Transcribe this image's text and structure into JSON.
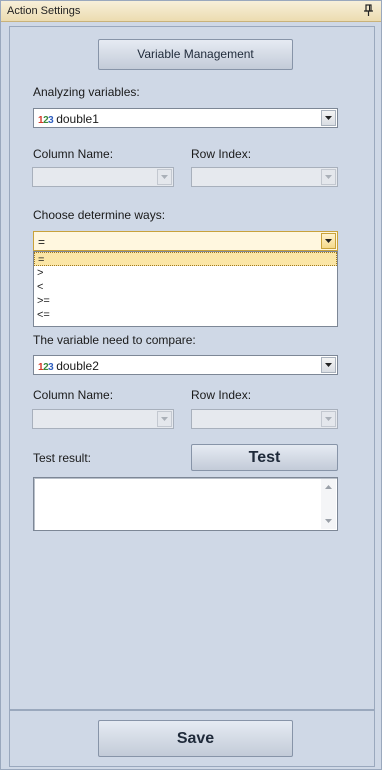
{
  "window": {
    "title": "Action Settings"
  },
  "buttons": {
    "variable_management": "Variable Management",
    "test": "Test",
    "save": "Save"
  },
  "analyzing": {
    "label": "Analyzing variables:",
    "value": "double1",
    "column_label": "Column Name:",
    "row_label": "Row Index:"
  },
  "determine": {
    "label": "Choose determine ways:",
    "value": "=",
    "options": [
      "=",
      ">",
      "<",
      ">=",
      "<="
    ]
  },
  "compare": {
    "label": "The variable need to compare:",
    "value": "double2",
    "column_label": "Column Name:",
    "row_label": "Row Index:"
  },
  "test_result": {
    "label": "Test result:",
    "value": ""
  },
  "icons": {
    "pin": "pin-icon",
    "number": "numeric-type-icon",
    "dropdown": "chevron-down-icon"
  },
  "colors": {
    "title_bar": "#ecdcb0",
    "panel_bg": "#cfd8e6",
    "dropdown_highlight": "#fbe6a6"
  }
}
